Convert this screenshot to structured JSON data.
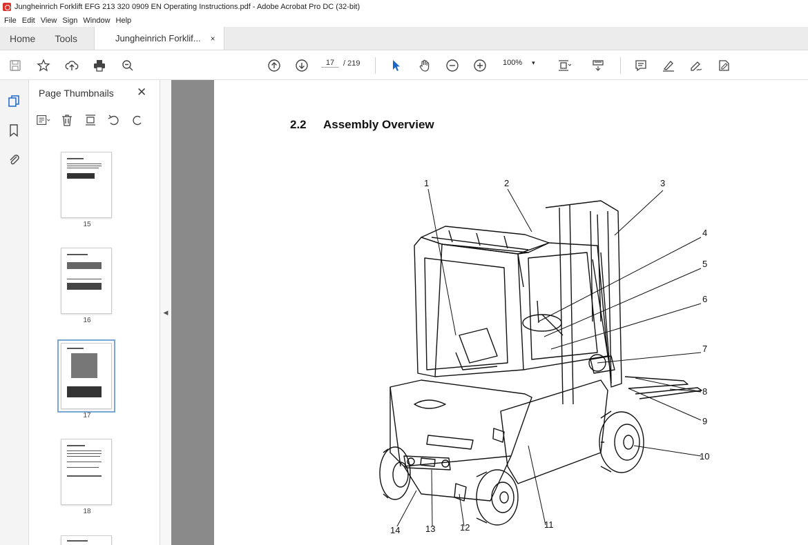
{
  "window": {
    "title": "Jungheinrich Forklift EFG 213 320 0909 EN Operating Instructions.pdf - Adobe Acrobat Pro DC (32-bit)"
  },
  "menu": [
    "File",
    "Edit",
    "View",
    "Sign",
    "Window",
    "Help"
  ],
  "tabs": {
    "home": "Home",
    "tools": "Tools",
    "document": "Jungheinrich Forklif...",
    "close_glyph": "×"
  },
  "toolbar": {
    "current_page": "17",
    "total_pages": "/ 219",
    "zoom": "100%",
    "zoom_caret": "▾"
  },
  "panel": {
    "title": "Page Thumbnails",
    "close_glyph": "✕",
    "thumbnails": [
      {
        "label": "15",
        "selected": false
      },
      {
        "label": "16",
        "selected": false
      },
      {
        "label": "17",
        "selected": true
      },
      {
        "label": "18",
        "selected": false
      }
    ]
  },
  "document": {
    "section_number": "2.2",
    "section_title": "Assembly Overview",
    "callouts": [
      "1",
      "2",
      "3",
      "4",
      "5",
      "6",
      "7",
      "8",
      "9",
      "10",
      "11",
      "12",
      "13",
      "14"
    ]
  },
  "colors": {
    "accent_blue": "#1a66c9",
    "gutter_gray": "#8a8a8a",
    "acrobat_red": "#d9322c"
  },
  "icons": [
    "save-icon",
    "star-icon",
    "upload-cloud-icon",
    "print-icon",
    "zoom-search-icon",
    "page-up-icon",
    "page-down-icon",
    "select-cursor-icon",
    "hand-icon",
    "zoom-out-icon",
    "zoom-in-icon",
    "fit-page-icon",
    "scroll-mode-icon",
    "comment-icon",
    "highlight-icon",
    "sign-icon",
    "fill-sign-icon",
    "thumbnails-icon",
    "bookmark-icon",
    "attachment-icon"
  ]
}
